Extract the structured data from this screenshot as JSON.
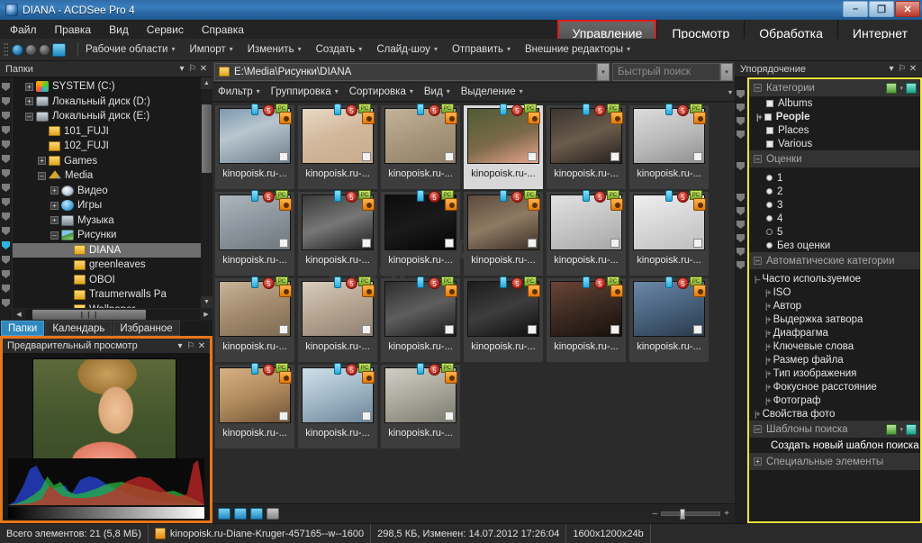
{
  "window": {
    "title": "DIANA - ACDSee Pro 4",
    "minimize": "–",
    "maximize": "❐",
    "close": "✕"
  },
  "menubar": [
    "Файл",
    "Правка",
    "Вид",
    "Сервис",
    "Справка"
  ],
  "modetabs": [
    {
      "label": "Управление",
      "active": true
    },
    {
      "label": "Просмотр",
      "active": false
    },
    {
      "label": "Обработка",
      "active": false
    },
    {
      "label": "Интернет",
      "active": false
    }
  ],
  "toolbar": {
    "items": [
      "Рабочие области",
      "Импорт",
      "Изменить",
      "Создать",
      "Слайд-шоу",
      "Отправить",
      "Внешние редакторы"
    ],
    "caret": "▾"
  },
  "folders_panel": {
    "title": "Папки",
    "collapse": "▾",
    "pin": "⚐",
    "close": "✕",
    "tree": [
      {
        "label": "SYSTEM (C:)",
        "indent": 1,
        "expander": "+",
        "icon": "windows-drive-icon"
      },
      {
        "label": "Локальный диск (D:)",
        "indent": 1,
        "expander": "+",
        "icon": "drive-icon"
      },
      {
        "label": "Локальный диск (E:)",
        "indent": 1,
        "expander": "–",
        "icon": "drive-icon"
      },
      {
        "label": "101_FUJI",
        "indent": 2,
        "expander": "",
        "icon": "folder-icon"
      },
      {
        "label": "102_FUJI",
        "indent": 2,
        "expander": "",
        "icon": "folder-icon"
      },
      {
        "label": "Games",
        "indent": 2,
        "expander": "+",
        "icon": "folder-icon"
      },
      {
        "label": "Media",
        "indent": 2,
        "expander": "–",
        "icon": "media-icon"
      },
      {
        "label": "Видео",
        "indent": 3,
        "expander": "+",
        "icon": "video-icon"
      },
      {
        "label": "Игры",
        "indent": 3,
        "expander": "+",
        "icon": "games-icon"
      },
      {
        "label": "Музыка",
        "indent": 3,
        "expander": "+",
        "icon": "music-icon"
      },
      {
        "label": "Рисунки",
        "indent": 3,
        "expander": "–",
        "icon": "pictures-icon"
      },
      {
        "label": "DIANA",
        "indent": 4,
        "expander": "",
        "icon": "folder-icon",
        "selected": true
      },
      {
        "label": "greenleaves",
        "indent": 4,
        "expander": "",
        "icon": "folder-icon"
      },
      {
        "label": "OBOI",
        "indent": 4,
        "expander": "",
        "icon": "folder-icon"
      },
      {
        "label": "Traumerwalls Pa",
        "indent": 4,
        "expander": "",
        "icon": "folder-icon"
      },
      {
        "label": "Wallpaper",
        "indent": 4,
        "expander": "",
        "icon": "folder-icon"
      }
    ],
    "scroll_up": "▲",
    "scroll_down": "▼",
    "scroll_left": "◀",
    "scroll_right": "▶",
    "hthumb_grip": "❙❙❙"
  },
  "left_tabs": [
    {
      "label": "Папки",
      "active": true
    },
    {
      "label": "Календарь",
      "active": false
    },
    {
      "label": "Избранное",
      "active": false
    }
  ],
  "preview_panel": {
    "title": "Предварительный просмотр",
    "collapse": "▾",
    "pin": "⚐",
    "close": "✕",
    "border_color": "#e8761a"
  },
  "browser": {
    "path": "E:\\Media\\Рисунки\\DIANA",
    "path_dropdown": "▾",
    "search_placeholder": "Быстрый поиск",
    "search_dropdown": "▾",
    "filter_items": [
      "Фильтр",
      "Группировка",
      "Сортировка",
      "Вид",
      "Выделение"
    ],
    "filter_caret": "▾",
    "filter_overflow": "▾",
    "thumb_label": "kinopoisk.ru-...",
    "rating_badge": "5",
    "green_badge": "РС",
    "rows": [
      [
        {
          "bg": "linear-gradient(160deg,#7c98ae 0%,#b9c6cf 40%,#6d7f8c 100%)",
          "subject": "portrait-blue"
        },
        {
          "bg": "linear-gradient(160deg,#e8d9c4 0%,#d2b79a 50%,#c9ab8c 100%)",
          "subject": "blonde-wall"
        },
        {
          "bg": "linear-gradient(160deg,#c2b39a 0%,#a8977c 50%,#8e7f66 100%)",
          "subject": "stone-wall"
        },
        {
          "bg": "linear-gradient(160deg,#4e5c33 0%,#7d6a4a 55%,#e9a58e 100%)",
          "subject": "close-up",
          "selected": true
        },
        {
          "bg": "linear-gradient(160deg,#3a3430 0%,#6b5b4c 50%,#241f1c 100%)",
          "subject": "fur-coat"
        },
        {
          "bg": "linear-gradient(160deg,#dcdcdc 0%,#b8b8b8 55%,#8f8f8f 100%)",
          "subject": "white-bg"
        }
      ],
      [
        {
          "bg": "linear-gradient(160deg,#aeb6bd 0%,#8d969e 50%,#6e767c 100%)",
          "subject": "rooftop"
        },
        {
          "bg": "linear-gradient(160deg,#3a3a3a 0%,#777 50%,#1c1c1c 100%)",
          "subject": "bw-portrait"
        },
        {
          "bg": "linear-gradient(160deg,#0c0c0c 0%,#1a1a1a 50%,#050505 100%)",
          "subject": "black-bg-white-shirt"
        },
        {
          "bg": "linear-gradient(160deg,#5b4a3c 0%,#8f7a63 50%,#3a2f26 100%)",
          "subject": "warm-portrait"
        },
        {
          "bg": "linear-gradient(160deg,#e2e2e2 0%,#c5c5c5 50%,#a6a6a6 100%)",
          "subject": "light-portrait"
        },
        {
          "bg": "linear-gradient(160deg,#efefef 0%,#d6d6d6 50%,#bdbdbd 100%)",
          "subject": "white-shirt"
        }
      ],
      [
        {
          "bg": "linear-gradient(160deg,#c8b49a 0%,#a28a6d 50%,#7d6a52 100%)",
          "subject": "outdoor"
        },
        {
          "bg": "linear-gradient(160deg,#d9cdbd 0%,#b5a490 50%,#8e8073 100%)",
          "subject": "soft-portrait"
        },
        {
          "bg": "linear-gradient(160deg,#2e2e2e 0%,#5e5e5e 50%,#1a1a1a 100%)",
          "subject": "bw-studio"
        },
        {
          "bg": "linear-gradient(160deg,#1c1c1c 0%,#3d3d3d 50%,#0e0e0e 100%)",
          "subject": "dark-dress"
        },
        {
          "bg": "linear-gradient(160deg,#6b4436 0%,#3b2a21 50%,#170f0c 100%)",
          "subject": "dark-warm"
        },
        {
          "bg": "linear-gradient(160deg,#6c88a8 0%,#48617d 50%,#2a3a4c 100%)",
          "subject": "blue-tone"
        }
      ],
      [
        {
          "bg": "linear-gradient(160deg,#d7b183 0%,#b08a5d 50%,#6f5436 100%)",
          "subject": "face-close"
        },
        {
          "bg": "linear-gradient(160deg,#cfe0ea 0%,#9fb6c6 50%,#6d8598 100%)",
          "subject": "seaside"
        },
        {
          "bg": "linear-gradient(160deg,#cfcfc5 0%,#a9a79a 50%,#7b7a6f 100%)",
          "subject": "chair-pose"
        }
      ]
    ],
    "bottom_tools": [
      "rotate-left-icon",
      "rotate-right-icon",
      "flip-icon",
      "print-icon"
    ],
    "zoom_minus": "–",
    "zoom_plus": "+"
  },
  "organize_panel": {
    "title": "Упорядочение",
    "collapse": "▾",
    "pin": "⚐",
    "close": "✕",
    "highlight_color": "#f2e23a",
    "sections": {
      "categories": {
        "header": "Категории",
        "toggle": "–",
        "items": [
          {
            "label": "Albums",
            "bold": false,
            "expander": ""
          },
          {
            "label": "People",
            "bold": true,
            "expander": "+"
          },
          {
            "label": "Places",
            "bold": false,
            "expander": ""
          },
          {
            "label": "Various",
            "bold": false,
            "expander": ""
          }
        ]
      },
      "ratings": {
        "header": "Оценки",
        "toggle": "–",
        "items": [
          {
            "label": "1",
            "hollow": false
          },
          {
            "label": "2",
            "hollow": false
          },
          {
            "label": "3",
            "hollow": false
          },
          {
            "label": "4",
            "hollow": false
          },
          {
            "label": "5",
            "hollow": true
          },
          {
            "label": "Без оценки",
            "hollow": false
          }
        ]
      },
      "auto_categories": {
        "header": "Автоматические категории",
        "toggle": "–",
        "items": [
          {
            "label": "Часто используемое",
            "indent": 0,
            "expander": "–"
          },
          {
            "label": "ISO",
            "indent": 1,
            "expander": "+"
          },
          {
            "label": "Автор",
            "indent": 1,
            "expander": "+"
          },
          {
            "label": "Выдержка затвора",
            "indent": 1,
            "expander": "+"
          },
          {
            "label": "Диафрагма",
            "indent": 1,
            "expander": "+"
          },
          {
            "label": "Ключевые слова",
            "indent": 1,
            "expander": "+"
          },
          {
            "label": "Размер файла",
            "indent": 1,
            "expander": "+"
          },
          {
            "label": "Тип изображения",
            "indent": 1,
            "expander": "+"
          },
          {
            "label": "Фокусное расстояние",
            "indent": 1,
            "expander": "+"
          },
          {
            "label": "Фотограф",
            "indent": 1,
            "expander": "+"
          },
          {
            "label": "Свойства фото",
            "indent": 0,
            "expander": "+"
          }
        ]
      },
      "search_templates": {
        "header": "Шаблоны поиска",
        "toggle": "–",
        "link": "Создать новый шаблон поиска"
      },
      "special_items": {
        "header": "Специальные элементы",
        "toggle": "+"
      }
    }
  },
  "statusbar": {
    "total": "Всего элементов: 21  (5,8 МБ)",
    "filename": "kinopoisk.ru-Diane-Kruger-457165--w--1600",
    "fileinfo": "298,5 КБ, Изменен: 14.07.2012 17:26:04",
    "dimensions": "1600x1200x24b"
  },
  "watermark": "fullsilence.ru"
}
